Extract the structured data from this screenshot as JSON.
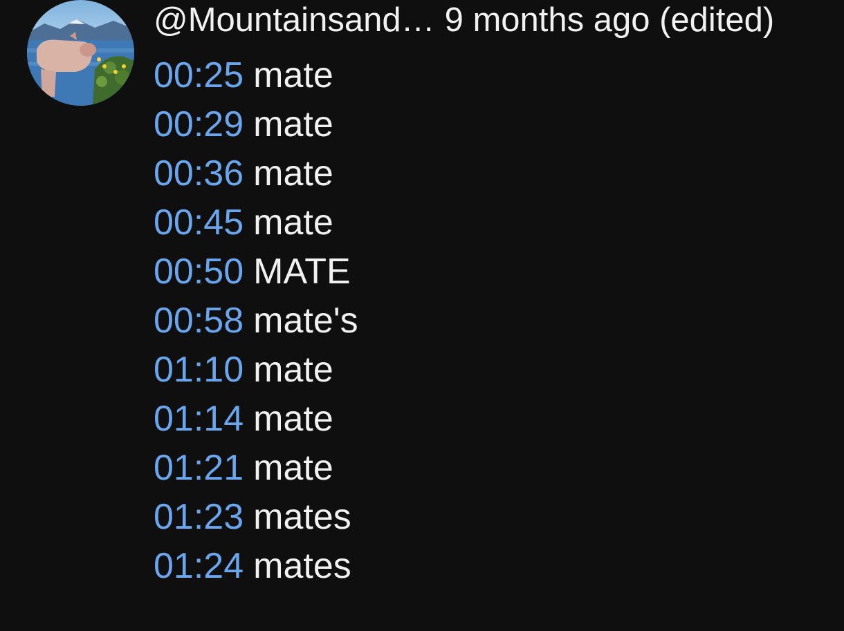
{
  "comment": {
    "author": "@Mountainsand…",
    "time": "9 months ago (edited)",
    "avatar_icon": "mountain-lake-photo-avatar",
    "timestamp_color": "#6aa6ee",
    "text_color": "#f1f1f1",
    "background": "#0f0f0f",
    "lines": [
      {
        "timestamp": "00:25",
        "text": "mate"
      },
      {
        "timestamp": "00:29",
        "text": "mate"
      },
      {
        "timestamp": "00:36",
        "text": "mate"
      },
      {
        "timestamp": "00:45",
        "text": "mate"
      },
      {
        "timestamp": "00:50",
        "text": "MATE"
      },
      {
        "timestamp": "00:58",
        "text": "mate's"
      },
      {
        "timestamp": "01:10",
        "text": "mate"
      },
      {
        "timestamp": "01:14",
        "text": "mate"
      },
      {
        "timestamp": "01:21",
        "text": "mate"
      },
      {
        "timestamp": "01:23",
        "text": "mates"
      },
      {
        "timestamp": "01:24",
        "text": "mates"
      }
    ]
  }
}
